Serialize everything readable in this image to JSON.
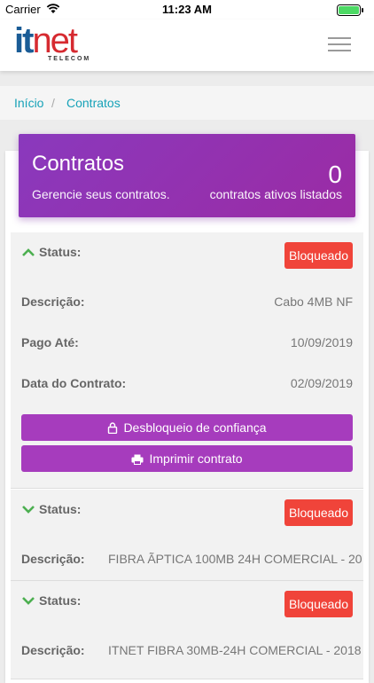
{
  "statusbar": {
    "carrier": "Carrier",
    "time": "11:23 AM"
  },
  "header": {
    "logo_it": "it",
    "logo_net": "net",
    "logo_sub": "TELECOM"
  },
  "breadcrumb": {
    "home": "Início",
    "current": "Contratos"
  },
  "hero": {
    "title": "Contratos",
    "subtitle": "Gerencie seus contratos.",
    "count": "0",
    "count_label": "contratos ativos listados"
  },
  "contracts": [
    {
      "status_label": "Status:",
      "status": "Bloqueado",
      "expanded": true,
      "descricao_label": "Descrição:",
      "descricao": "Cabo 4MB NF",
      "pago_label": "Pago Até:",
      "pago": "10/09/2019",
      "data_label": "Data do Contrato:",
      "data": "02/09/2019",
      "btn_unlock": "Desbloqueio de confiança",
      "btn_print": "Imprimir contrato"
    },
    {
      "status_label": "Status:",
      "status": "Bloqueado",
      "expanded": false,
      "descricao_label": "Descrição:",
      "descricao": "FIBRA ÃPTICA 100MB 24H COMERCIAL - 20"
    },
    {
      "status_label": "Status:",
      "status": "Bloqueado",
      "expanded": false,
      "descricao_label": "Descrição:",
      "descricao": "ITNET FIBRA 30MB-24H COMERCIAL - 2018"
    }
  ],
  "colors": {
    "accent": "#9b2ba4",
    "badge": "#f0443a",
    "link": "#17a2b8",
    "chevron": "#4caf50"
  }
}
